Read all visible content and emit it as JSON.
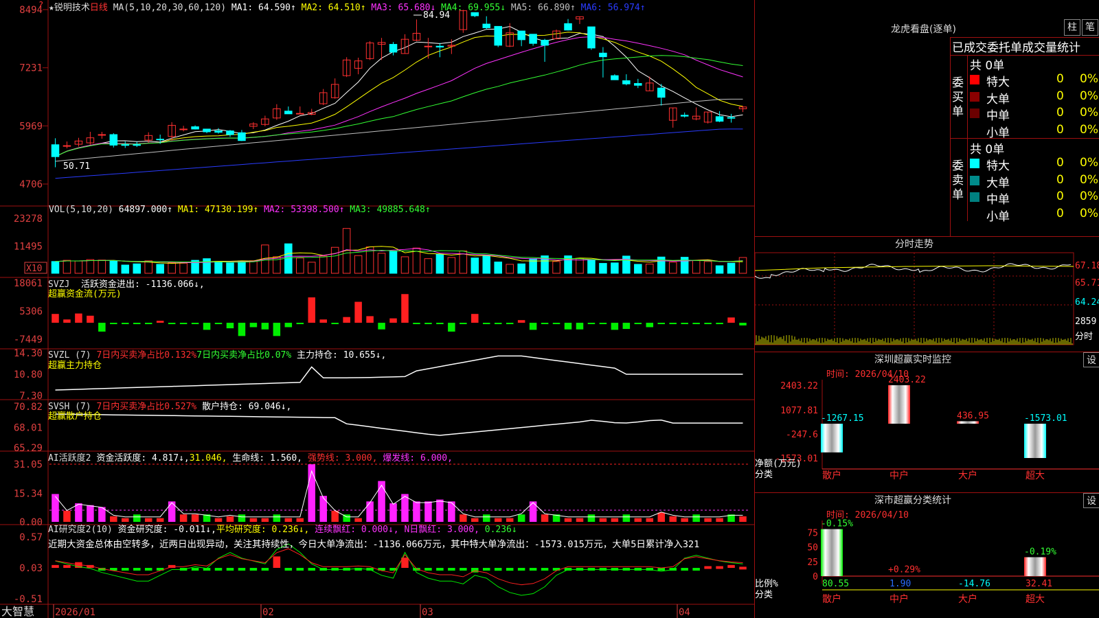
{
  "stock": {
    "star": "★",
    "name": "锐明技术",
    "period": "日线"
  },
  "main": {
    "ma_label": "MA(5,10,20,30,60,120)",
    "ma": [
      {
        "t": "MA1: 64.590↑",
        "c": "#ffffff"
      },
      {
        "t": "MA2: 64.510↑",
        "c": "#ffff00"
      },
      {
        "t": "MA3: 65.680↓",
        "c": "#ff33ff"
      },
      {
        "t": "MA4: 69.955↓",
        "c": "#33ff33"
      },
      {
        "t": "MA5: 66.890↑",
        "c": "#c0c0c0"
      },
      {
        "t": "MA6: 56.974↑",
        "c": "#2a3cff"
      }
    ],
    "yticks": [
      "8494",
      "7231",
      "5969",
      "4706"
    ],
    "high_label": "84.94",
    "low_label": "50.71",
    "corner_mark": "?"
  },
  "vol": {
    "label": "VOL(5,10,20)",
    "v": "64897.000↑",
    "ma": [
      {
        "t": "MA1: 47130.199↑",
        "c": "#ffff00"
      },
      {
        "t": "MA2: 53398.500↑",
        "c": "#ff33ff"
      },
      {
        "t": "MA3: 49885.648↑",
        "c": "#33ff33"
      }
    ],
    "yticks": [
      "23278",
      "11495"
    ],
    "unit": "X10"
  },
  "svzj": {
    "name": "SVZJ",
    "label": "活跃资金进出: -1136.066↓,",
    "sub": "超赢资金流(万元)",
    "yticks": [
      "18061",
      "5306",
      "-7449"
    ]
  },
  "svzl": {
    "name": "SVZL (7)",
    "a": "7日内买卖净占比0.132%",
    "b": "7日内买卖净占比0.07%",
    "c": "主力持仓: 10.655↓,",
    "sub": "超赢主力持仓",
    "yticks": [
      "14.30",
      "10.80",
      "7.30"
    ]
  },
  "svsh": {
    "name": "SVSH (7)",
    "a": "7日内买卖净占比0.527%",
    "c": "散户持仓: 69.046↓,",
    "sub": "超赢散户持仓",
    "yticks": [
      "70.82",
      "68.01",
      "65.29"
    ]
  },
  "ai2": {
    "name": "AI活跃度2",
    "a": "资金活跃度: 4.817↓",
    "b": "31.046,",
    "c": "生命线: 1.560,",
    "d": "强势线: 3.000,",
    "e": "爆发线: 6.000,",
    "yticks": [
      "31.05",
      "15.34",
      "0.00"
    ]
  },
  "ai3": {
    "name": "AI研究度2(10)",
    "a": "资金研究度: -0.011↓,",
    "b": "平均研究度: 0.236↓,",
    "c": "连续飘红: 0.000↓,",
    "d": "N日飘红: 3.000,",
    "e": "0.236↓",
    "comment": "近期大资金总体由空转多，近两日出现异动，关注其持续性，今日大单净流出：-1136.066万元，其中特大单净流出：-1573.015万元，大单5日累计净入321",
    "yticks": [
      "0.57",
      "0.03",
      "-0.51"
    ]
  },
  "xaxis": {
    "brand": "大智慧",
    "dates": [
      "2026/01",
      "02",
      "03",
      "04"
    ]
  },
  "lhb": {
    "title": "龙虎看盘(逐单)",
    "btn1": "柱",
    "btn2": "笔",
    "tabs": "已成交委托单成交量统计",
    "buy": {
      "side": "委买单",
      "total": "共 0单",
      "rows": [
        [
          "特大",
          "0",
          "0%"
        ],
        [
          "大单",
          "0",
          "0%"
        ],
        [
          "中单",
          "0",
          "0%"
        ],
        [
          "小单",
          "0",
          "0%"
        ]
      ]
    },
    "sell": {
      "side": "委卖单",
      "total": "共 0单",
      "rows": [
        [
          "特大",
          "0",
          "0%"
        ],
        [
          "大单",
          "0",
          "0%"
        ],
        [
          "中单",
          "0",
          "0%"
        ],
        [
          "小单",
          "0",
          "0%"
        ]
      ]
    },
    "buy_colors": [
      "#ff0000",
      "#8b0000",
      "#6b0000",
      ""
    ],
    "sell_colors": [
      "#00ffff",
      "#008b8b",
      "#008080",
      ""
    ]
  },
  "fenshi": {
    "title": "分时走势",
    "yticks": [
      "67.18",
      "65.71",
      "64.24",
      "2859"
    ],
    "unit": "分时"
  },
  "sz": {
    "title": "深圳超赢实时监控",
    "set": "设",
    "time": "时间: 2026/04/10",
    "yticks": [
      "2403.22",
      "1077.81",
      "-247.6",
      "-1573.01"
    ],
    "ylabel": "净额(万元)",
    "xlabel": "分类",
    "cats": [
      "散户",
      "中户",
      "大户",
      "超大"
    ],
    "values": [
      -1267.15,
      2403.22,
      436.95,
      -1573.01
    ],
    "labels": [
      "-1267.15",
      "2403.22",
      "436.95",
      "-1573.01"
    ]
  },
  "ss": {
    "title": "深市超赢分类统计",
    "set": "设",
    "time": "时间: 2026/04/10",
    "yticks": [
      "75",
      "50",
      "25",
      "0"
    ],
    "ylabel": "比例%",
    "xlabel": "分类",
    "cats": [
      "散户",
      "中户",
      "大户",
      "超大"
    ],
    "pct": [
      80.55,
      1.9,
      -14.76,
      32.41
    ],
    "values": [
      "80.55",
      "1.90",
      "-14.76",
      "32.41"
    ],
    "changes": [
      "-0.15%",
      "+0.29%",
      "",
      "-0.19%"
    ]
  },
  "chart_data": {
    "type": "candlestick",
    "note_axis": "price ×100",
    "x": [
      0,
      1,
      2,
      3,
      4,
      5,
      6,
      7,
      8,
      9,
      10,
      11,
      12,
      13,
      14,
      15,
      16,
      17,
      18,
      19,
      20,
      21,
      22,
      23,
      24,
      25,
      26,
      27,
      28,
      29,
      30,
      31,
      32,
      33,
      34,
      35,
      36,
      37,
      38,
      39,
      40,
      41,
      42,
      43,
      44,
      45,
      46,
      47,
      48,
      49,
      50,
      51,
      52,
      53,
      54,
      55,
      56,
      57,
      58,
      59
    ],
    "ohlc": [
      [
        5560,
        5300,
        5700,
        5070
      ],
      [
        5530,
        5540,
        5630,
        5480
      ],
      [
        5570,
        5640,
        5710,
        5520
      ],
      [
        5600,
        5710,
        5840,
        5560
      ],
      [
        5780,
        5780,
        5840,
        5690
      ],
      [
        5780,
        5550,
        5810,
        5500
      ],
      [
        5560,
        5550,
        5630,
        5490
      ],
      [
        5560,
        5550,
        5620,
        5510
      ],
      [
        5660,
        5760,
        5830,
        5610
      ],
      [
        5680,
        5670,
        5780,
        5580
      ],
      [
        5740,
        5980,
        6050,
        5650
      ],
      [
        5900,
        5900,
        5970,
        5850
      ],
      [
        5950,
        5900,
        5980,
        5890
      ],
      [
        5900,
        5840,
        5880,
        5810
      ],
      [
        5860,
        5830,
        5920,
        5800
      ],
      [
        5860,
        5780,
        5880,
        5730
      ],
      [
        5820,
        5650,
        5880,
        5640
      ],
      [
        5960,
        6010,
        6050,
        5900
      ],
      [
        6000,
        6120,
        6190,
        5960
      ],
      [
        6140,
        6340,
        6440,
        6100
      ],
      [
        6290,
        6230,
        6390,
        6230
      ],
      [
        6240,
        6240,
        6390,
        6240
      ],
      [
        6220,
        6260,
        6340,
        6200
      ],
      [
        6450,
        6690,
        6770,
        6420
      ],
      [
        6580,
        6870,
        7000,
        6560
      ],
      [
        7060,
        7400,
        7460,
        7030
      ],
      [
        7220,
        7380,
        7450,
        7090
      ],
      [
        7430,
        7770,
        7810,
        7400
      ],
      [
        7740,
        7780,
        7880,
        7400
      ],
      [
        7740,
        7570,
        7790,
        7500
      ],
      [
        7540,
        7850,
        7960,
        7600
      ],
      [
        7830,
        7980,
        8280,
        7810
      ],
      [
        7700,
        7700,
        7880,
        7430
      ],
      [
        7700,
        7680,
        7770,
        7460
      ],
      [
        7700,
        7720,
        7850,
        7530
      ],
      [
        8060,
        8470,
        8490,
        7990
      ],
      [
        8430,
        8360,
        8420,
        8330
      ],
      [
        8180,
        8100,
        8350,
        8060
      ],
      [
        8130,
        7720,
        7830,
        7680
      ],
      [
        7700,
        7990,
        8200,
        7680
      ],
      [
        8030,
        7840,
        7970,
        7700
      ],
      [
        7960,
        7760,
        7920,
        7710
      ],
      [
        7830,
        7720,
        7860,
        7360
      ],
      [
        7860,
        8030,
        8060,
        7850
      ],
      [
        8190,
        8050,
        8290,
        8040
      ],
      [
        8290,
        8340,
        8280,
        8180
      ],
      [
        8120,
        7660,
        8060,
        7620
      ],
      [
        7550,
        7470,
        7680,
        7020
      ],
      [
        7060,
        6970,
        7090,
        6970
      ],
      [
        6950,
        6880,
        7090,
        6850
      ],
      [
        6890,
        6850,
        6990,
        6790
      ],
      [
        6730,
        6900,
        7040,
        6860
      ],
      [
        6790,
        6590,
        6880,
        6410
      ],
      [
        6090,
        6360,
        6360,
        5930
      ],
      [
        6200,
        6180,
        6260,
        6150
      ],
      [
        6120,
        6180,
        6370,
        6090
      ],
      [
        6050,
        6270,
        6230,
        6020
      ],
      [
        6170,
        6070,
        6290,
        6050
      ],
      [
        6150,
        6140,
        6230,
        6040
      ],
      [
        6340,
        6380,
        6400,
        6270
      ]
    ]
  }
}
